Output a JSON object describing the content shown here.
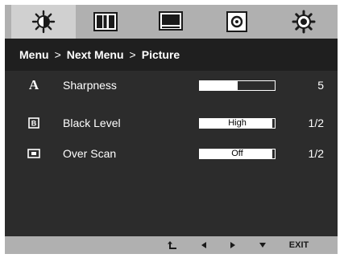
{
  "tabs": [
    {
      "icon": "brightness-icon",
      "selected": true
    },
    {
      "icon": "contrast-icon",
      "selected": false
    },
    {
      "icon": "picture-icon",
      "selected": false
    },
    {
      "icon": "sound-icon",
      "selected": false
    },
    {
      "icon": "settings-icon",
      "selected": false
    }
  ],
  "breadcrumb": {
    "menu": "Menu",
    "sep1": ">",
    "next_menu": "Next Menu",
    "sep2": ">",
    "current": "Picture"
  },
  "rows": [
    {
      "icon": "sharpness-icon",
      "icon_text": "A",
      "label": "Sharpness",
      "control": "slider",
      "level": 5,
      "level_max": 10,
      "value": "5"
    },
    {
      "icon": "black-level-icon",
      "icon_text": "B",
      "label": "Black Level",
      "control": "option",
      "option": "High",
      "value": "1/2"
    },
    {
      "icon": "over-scan-icon",
      "label": "Over Scan",
      "control": "option",
      "option": "Off",
      "value": "1/2"
    }
  ],
  "bottom_bar": {
    "exit_label": "EXIT",
    "icons": [
      "return-icon",
      "left-arrow-icon",
      "right-arrow-icon",
      "down-arrow-icon"
    ]
  },
  "colors": {
    "panel": "#2c2c2c",
    "tab_bar": "#b0b0b0",
    "tab_selected": "#d0d0d0",
    "breadcrumb": "#1f1f1f",
    "text": "#ffffff"
  }
}
